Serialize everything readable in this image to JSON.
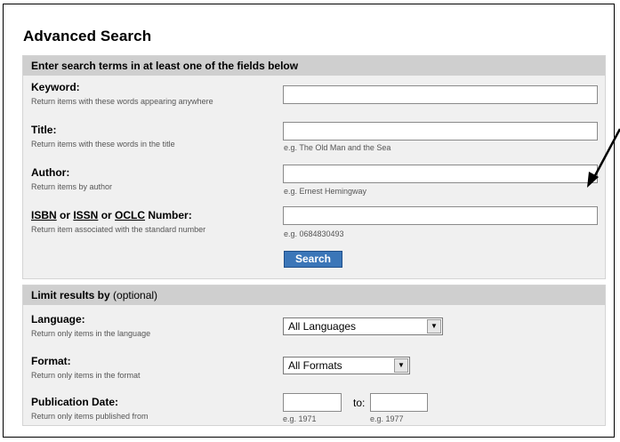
{
  "title": "Advanced Search",
  "search_section": {
    "header": "Enter search terms in at least one of the fields below",
    "fields": [
      {
        "label": "Keyword:",
        "help": "Return items with these words appearing anywhere",
        "value": "",
        "example": ""
      },
      {
        "label": "Title:",
        "help": "Return items with these words in the title",
        "value": "",
        "example": "e.g. The Old Man and the Sea"
      },
      {
        "label": "Author:",
        "help": "Return items by author",
        "value": "",
        "example": "e.g. Ernest Hemingway"
      },
      {
        "label_parts": [
          "ISBN",
          " or ",
          "ISSN",
          " or ",
          "OCLC",
          " Number:"
        ],
        "help": "Return item associated with the standard number",
        "value": "",
        "example": "e.g. 0684830493"
      }
    ],
    "search_button": "Search"
  },
  "limit_section": {
    "header_bold": "Limit results by",
    "header_optional": " (optional)",
    "language": {
      "label": "Language:",
      "help": "Return only items in the language",
      "selected": "All Languages"
    },
    "format": {
      "label": "Format:",
      "help": "Return only items in the format",
      "selected": "All Formats"
    },
    "pubdate": {
      "label": "Publication Date:",
      "help": "Return only items published from",
      "to_label": "to:",
      "from_example": "e.g. 1971",
      "to_example": "e.g. 1977"
    }
  },
  "icons": {
    "dropdown_arrow": "▼"
  }
}
